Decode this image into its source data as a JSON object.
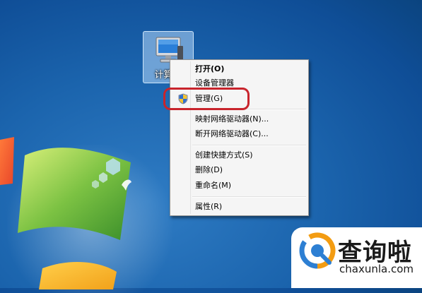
{
  "desktop": {
    "computer_icon": {
      "label": "计算机",
      "icon": "computer-monitor-icon"
    }
  },
  "context_menu": {
    "items": [
      {
        "label": "打开(O)",
        "bold": true
      },
      {
        "label": "设备管理器"
      },
      {
        "label": "管理(G)",
        "icon": "uac-shield-icon",
        "highlighted": true
      },
      {
        "label": "映射网络驱动器(N)..."
      },
      {
        "label": "断开网络驱动器(C)..."
      },
      {
        "label": "创建快捷方式(S)"
      },
      {
        "label": "删除(D)"
      },
      {
        "label": "重命名(M)"
      },
      {
        "label": "属性(R)"
      }
    ],
    "highlight_color": "#c8242c"
  },
  "watermark": {
    "brand": "查询啦",
    "url": "chaxunla.com",
    "logo_colors": [
      "#f39c12",
      "#2d7fd3"
    ]
  },
  "colors": {
    "desktop_blue": "#1b64ad",
    "menu_bg": "#f5f5f5"
  }
}
